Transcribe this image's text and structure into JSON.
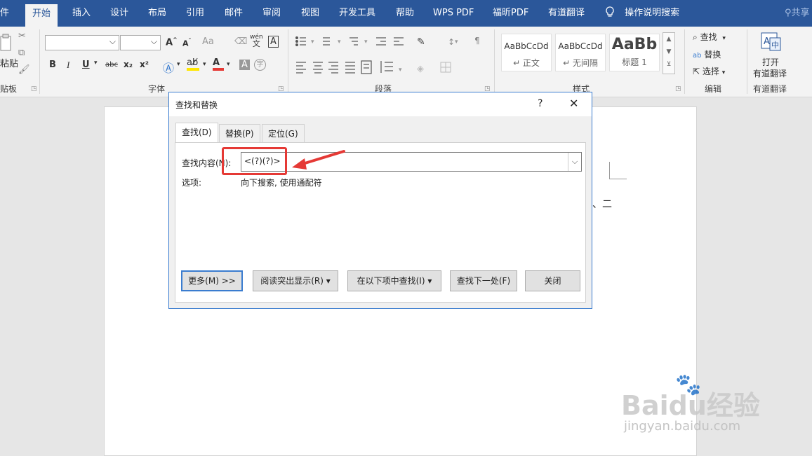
{
  "menubar": {
    "tabs": [
      "件",
      "开始",
      "插入",
      "设计",
      "布局",
      "引用",
      "邮件",
      "审阅",
      "视图",
      "开发工具",
      "帮助",
      "WPS PDF",
      "福昕PDF",
      "有道翻译"
    ],
    "tellme": "操作说明搜索",
    "share": "共享"
  },
  "ribbon": {
    "clipboard": {
      "paste": "粘贴",
      "label": "贴板"
    },
    "font": {
      "label": "字体",
      "grow": "A",
      "shrink": "A",
      "case": "Aa",
      "bold": "B",
      "italic": "I",
      "underline": "U",
      "strike": "abc",
      "sub": "x₂",
      "sup": "x²",
      "phonetic_top": "wén",
      "phonetic_bottom": "文",
      "border_char": "A",
      "fontcolor": "A",
      "shade": "A",
      "circle": "字"
    },
    "paragraph": {
      "label": "段落"
    },
    "styles": {
      "label": "样式",
      "items": [
        {
          "preview": "AaBbCcDd",
          "name": "↵ 正文"
        },
        {
          "preview": "AaBbCcDd",
          "name": "↵ 无间隔"
        },
        {
          "preview": "AaBb",
          "name": "标题 1"
        }
      ]
    },
    "editing": {
      "label": "编辑",
      "find": "查找",
      "replace": "替换",
      "select": "选择"
    },
    "youdao": {
      "line1": "打开",
      "line2": "有道翻译",
      "label": "有道翻译"
    }
  },
  "document": {
    "text": "、二"
  },
  "dialog": {
    "title": "查找和替换",
    "help": "?",
    "close": "✕",
    "tabs": [
      "查找(D)",
      "替换(P)",
      "定位(G)"
    ],
    "find_label": "查找内容(N):",
    "find_value": "<(?)(?)>",
    "options_label": "选项:",
    "options_value": "向下搜索, 使用通配符",
    "buttons": {
      "more": "更多(M) >>",
      "reading_highlight": "阅读突出显示(R) ▾",
      "find_in": "在以下项中查找(I) ▾",
      "find_next": "查找下一处(F)",
      "close": "关闭"
    }
  },
  "watermark": {
    "brand": "Baidu经验",
    "url": "jingyan.baidu.com"
  },
  "colors": {
    "accent": "#2b579a",
    "annotation": "#e53935",
    "dialog_border": "#3a7ccf"
  }
}
